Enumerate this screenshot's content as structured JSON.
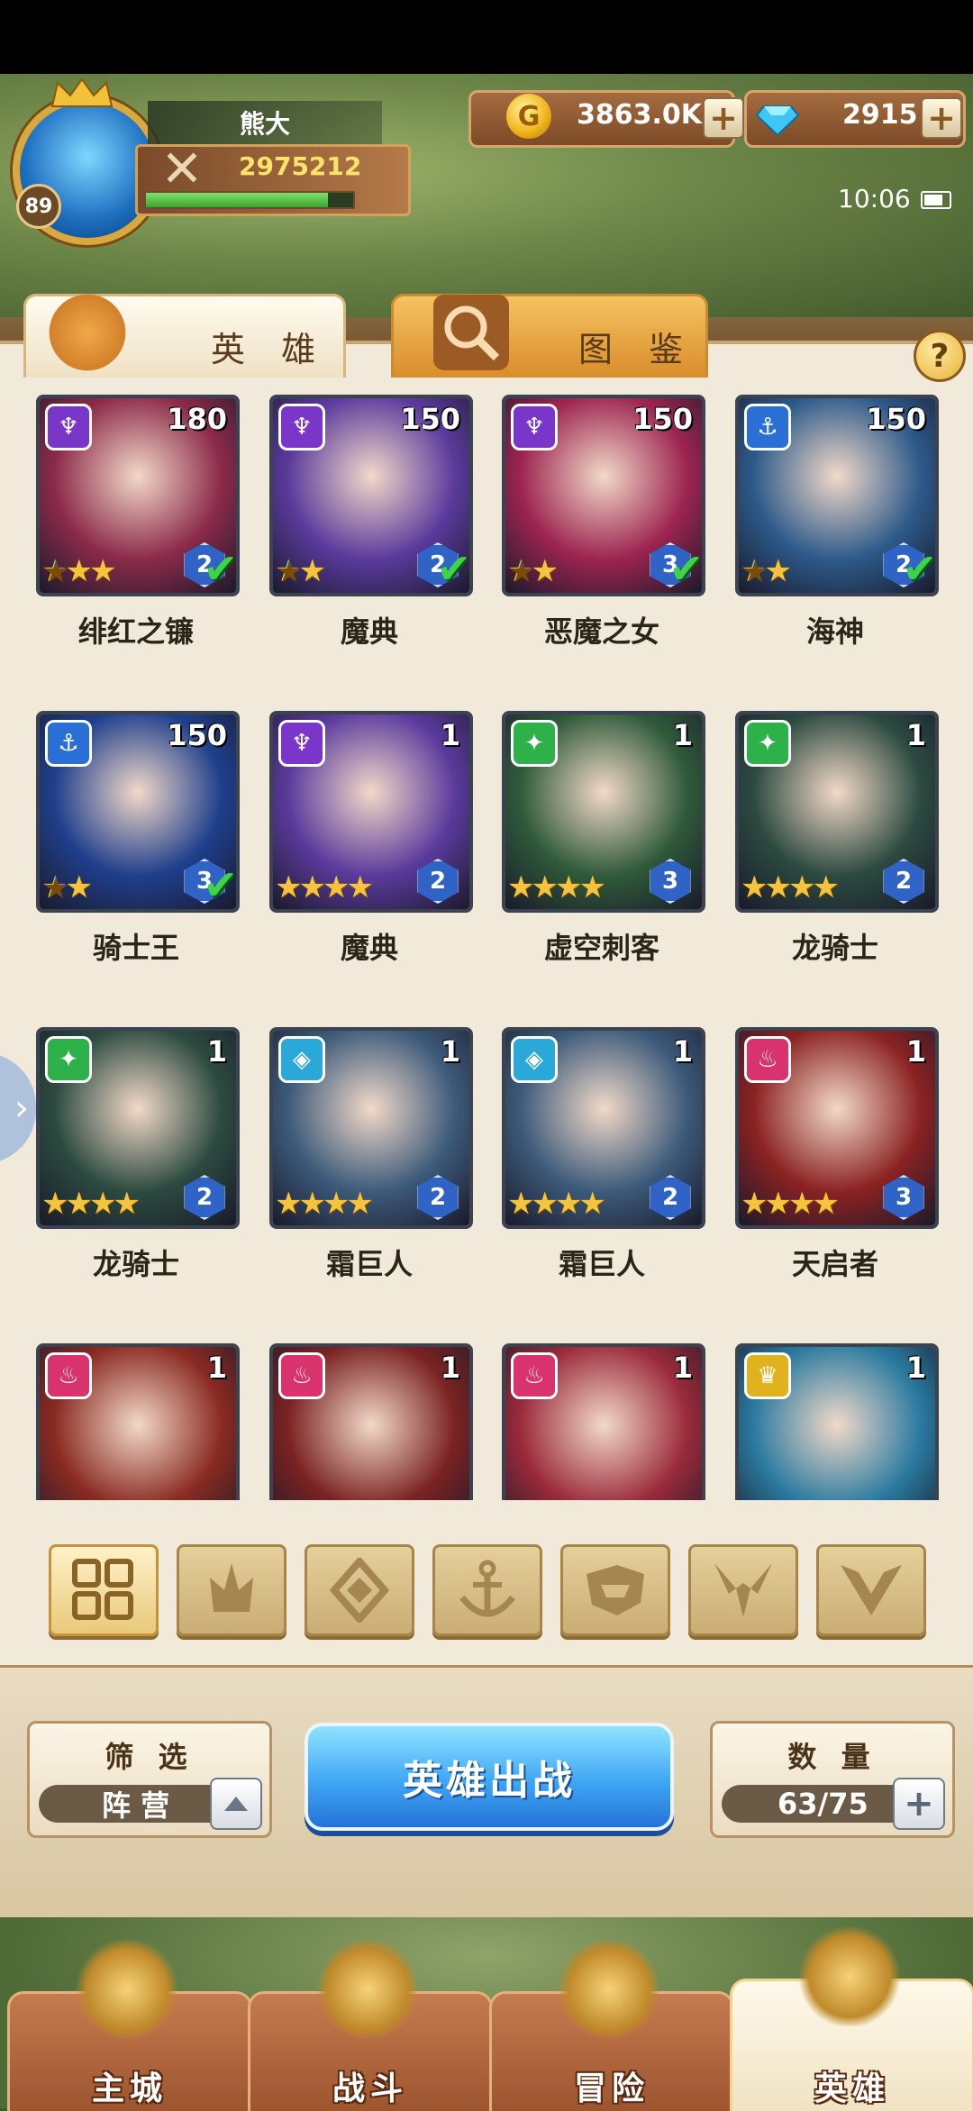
{
  "player": {
    "name": "熊大",
    "level": "89",
    "power": "2975212",
    "xp_fraction": 0.88
  },
  "currency": {
    "gold": "3863.0K",
    "gems": "2915",
    "plus": "+"
  },
  "status": {
    "time": "10:06"
  },
  "tabs": {
    "heroes": "英 雄",
    "gallery": "图 鉴",
    "help": "?"
  },
  "heroes": [
    {
      "name": "绯红之镰",
      "level": "180",
      "faction": "demon",
      "stars": 3,
      "rainbow": 1,
      "rank": "2",
      "deployed": true,
      "color": "#8b2a4a"
    },
    {
      "name": "魔典",
      "level": "150",
      "faction": "demon",
      "stars": 2,
      "rainbow": 1,
      "rank": "2",
      "deployed": true,
      "color": "#5a3a9c"
    },
    {
      "name": "恶魔之女",
      "level": "150",
      "faction": "demon",
      "stars": 2,
      "rainbow": 1,
      "rank": "3",
      "deployed": true,
      "color": "#9c2450"
    },
    {
      "name": "海神",
      "level": "150",
      "faction": "sea",
      "stars": 2,
      "rainbow": 1,
      "rank": "2",
      "deployed": true,
      "color": "#2d5a8a"
    },
    {
      "name": "骑士王",
      "level": "150",
      "faction": "sea",
      "stars": 2,
      "rainbow": 1,
      "rank": "3",
      "deployed": true,
      "color": "#1f3f8c"
    },
    {
      "name": "魔典",
      "level": "1",
      "faction": "demon",
      "stars": 4,
      "rainbow": 0,
      "rank": "2",
      "deployed": false,
      "color": "#5a3a9c"
    },
    {
      "name": "虚空刺客",
      "level": "1",
      "faction": "beast",
      "stars": 4,
      "rainbow": 0,
      "rank": "3",
      "deployed": false,
      "color": "#2f5a3a"
    },
    {
      "name": "龙骑士",
      "level": "1",
      "faction": "beast",
      "stars": 4,
      "rainbow": 0,
      "rank": "2",
      "deployed": false,
      "color": "#2c4a40"
    },
    {
      "name": "龙骑士",
      "level": "1",
      "faction": "beast",
      "stars": 4,
      "rainbow": 0,
      "rank": "2",
      "deployed": false,
      "color": "#2c4a40"
    },
    {
      "name": "霜巨人",
      "level": "1",
      "faction": "frost",
      "stars": 4,
      "rainbow": 0,
      "rank": "2",
      "deployed": false,
      "color": "#3c5a7a"
    },
    {
      "name": "霜巨人",
      "level": "1",
      "faction": "frost",
      "stars": 4,
      "rainbow": 0,
      "rank": "2",
      "deployed": false,
      "color": "#3c5a7a"
    },
    {
      "name": "天启者",
      "level": "1",
      "faction": "flame",
      "stars": 4,
      "rainbow": 0,
      "rank": "3",
      "deployed": false,
      "color": "#8a2222"
    },
    {
      "name": "",
      "level": "1",
      "faction": "flame",
      "stars": 0,
      "rainbow": 0,
      "rank": "",
      "deployed": false,
      "color": "#8a2a22"
    },
    {
      "name": "",
      "level": "1",
      "faction": "flame",
      "stars": 0,
      "rainbow": 0,
      "rank": "",
      "deployed": false,
      "color": "#7a2222"
    },
    {
      "name": "",
      "level": "1",
      "faction": "flame",
      "stars": 0,
      "rainbow": 0,
      "rank": "",
      "deployed": false,
      "color": "#9a2a3a"
    },
    {
      "name": "",
      "level": "1",
      "faction": "holy",
      "stars": 0,
      "rainbow": 0,
      "rank": "",
      "deployed": false,
      "color": "#2a7aa0"
    }
  ],
  "faction_colors": {
    "demon": "#7a35c9",
    "sea": "#2a6fd6",
    "beast": "#2fb14a",
    "frost": "#2aa8d8",
    "flame": "#d8336c",
    "holy": "#e0b21e"
  },
  "filters": [
    "all-icon",
    "flame-icon",
    "frost-icon",
    "anchor-icon",
    "beast-icon",
    "demon-icon",
    "holy-icon"
  ],
  "controls": {
    "filter_title": "筛 选",
    "filter_value": "阵 营",
    "deploy_label": "英雄出战",
    "count_title": "数 量",
    "count_value": "63/75"
  },
  "nav": [
    {
      "label": "主城",
      "icon": "castle-icon"
    },
    {
      "label": "战斗",
      "icon": "crossed-swords-icon"
    },
    {
      "label": "冒险",
      "icon": "scroll-icon"
    },
    {
      "label": "英雄",
      "icon": "hero-helmet-icon"
    }
  ]
}
